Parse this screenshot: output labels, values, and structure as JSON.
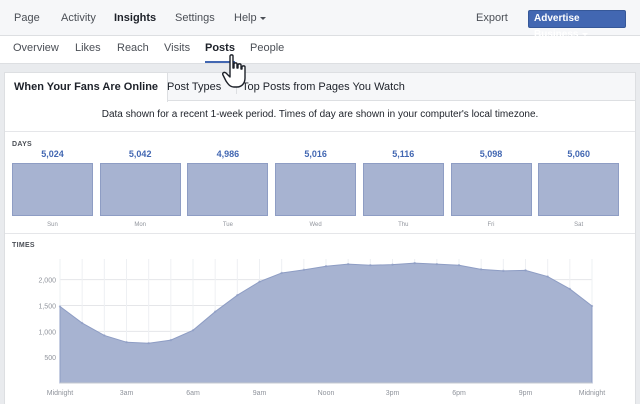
{
  "topnav": {
    "items": [
      {
        "label": "Page"
      },
      {
        "label": "Activity"
      },
      {
        "label": "Insights"
      },
      {
        "label": "Settings"
      },
      {
        "label": "Help"
      }
    ],
    "export_label": "Export",
    "advertise_label": "Advertise Business"
  },
  "subnav": {
    "tabs": [
      {
        "label": "Overview"
      },
      {
        "label": "Likes"
      },
      {
        "label": "Reach"
      },
      {
        "label": "Visits"
      },
      {
        "label": "Posts"
      },
      {
        "label": "People"
      }
    ]
  },
  "posts": {
    "tabs": [
      {
        "label": "When Your Fans Are Online"
      },
      {
        "label": "Post Types"
      },
      {
        "label": "Top Posts from Pages You Watch"
      }
    ],
    "note": "Data shown for a recent 1-week period. Times of day are shown in your computer's local timezone.",
    "days_label": "DAYS",
    "times_label": "TIMES"
  },
  "chart_data": [
    {
      "type": "bar",
      "title": "DAYS",
      "categories": [
        "Sun",
        "Mon",
        "Tue",
        "Wed",
        "Thu",
        "Fri",
        "Sat"
      ],
      "values": [
        5024,
        5042,
        4986,
        5016,
        5116,
        5098,
        5060
      ],
      "value_labels": [
        "5,024",
        "5,042",
        "4,986",
        "5,016",
        "5,116",
        "5,098",
        "5,060"
      ]
    },
    {
      "type": "area",
      "title": "TIMES",
      "x_tick_labels": [
        "Midnight",
        "3am",
        "6am",
        "9am",
        "Noon",
        "3pm",
        "6pm",
        "9pm",
        "Midnight"
      ],
      "y_tick_labels": [
        "500",
        "1,000",
        "1,500",
        "2,000"
      ],
      "ylim": [
        0,
        2400
      ],
      "grid": true,
      "x": [
        0,
        1,
        2,
        3,
        4,
        5,
        6,
        7,
        8,
        9,
        10,
        11,
        12,
        13,
        14,
        15,
        16,
        17,
        18,
        19,
        20,
        21,
        22,
        23,
        24
      ],
      "values": [
        1480,
        1160,
        920,
        790,
        770,
        830,
        1020,
        1380,
        1700,
        1960,
        2130,
        2190,
        2260,
        2300,
        2280,
        2290,
        2320,
        2300,
        2280,
        2200,
        2170,
        2180,
        2060,
        1820,
        1490
      ],
      "color": "#a7b3d1"
    }
  ],
  "colors": {
    "accent": "#4267b2",
    "bar_fill": "#a7b3d1"
  }
}
